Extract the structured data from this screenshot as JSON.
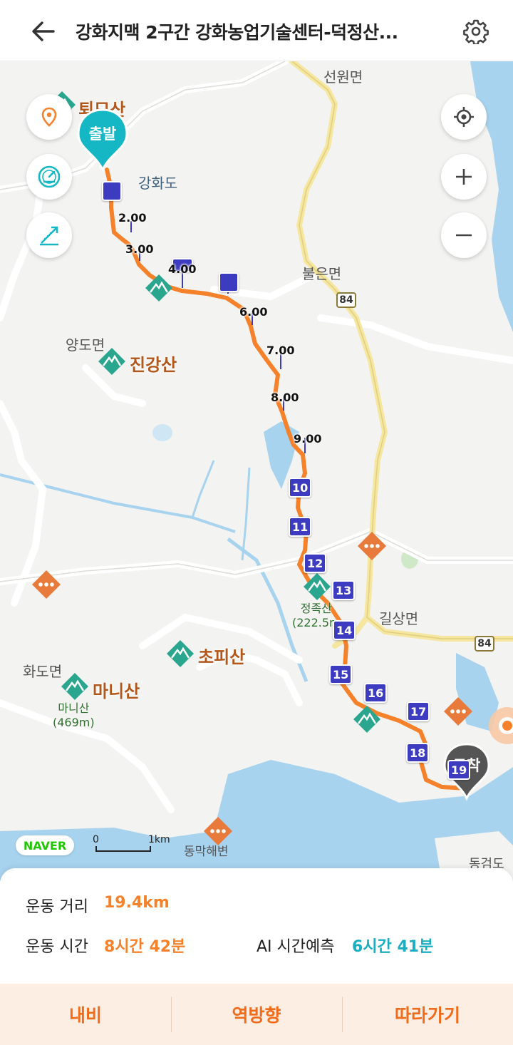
{
  "header": {
    "title": "강화지맥 2구간 강화농업기술센터-덕정산..."
  },
  "map": {
    "places": {
      "seonwon": "선원면",
      "ganghwado": "강화도",
      "bureun": "불은면",
      "yangdo": "양도면",
      "gilsang": "길상면",
      "hwado": "화도면",
      "dongmak": "동막해변",
      "donggeom": "동검도"
    },
    "mountains": {
      "toemo": "퇴모산",
      "jingang": "진강산",
      "chopi": "초피산",
      "mani": "마니산",
      "mani_sub1": "마니산",
      "mani_sub2": "(469m)",
      "jeongjok_sub1": "정족산",
      "jeongjok_sub2": "(222.5m"
    },
    "road_badges": [
      "84",
      "84"
    ],
    "start_label": "출발",
    "end_label": "도착",
    "km_labels": [
      "2.00",
      "3.00",
      "4.00",
      "6.00",
      "7.00",
      "8.00",
      "9.00"
    ],
    "km_boxes": [
      "10",
      "11",
      "12",
      "13",
      "14",
      "15",
      "16",
      "17",
      "18",
      "19"
    ],
    "scale": {
      "zero": "0",
      "unit": "1km"
    },
    "logo": "NAVER",
    "route_color": "#f5822a",
    "marker_color": "#3d3bbf"
  },
  "info": {
    "distance_label": "운동 거리",
    "distance_value": "19.4km",
    "time_label": "운동 시간",
    "time_value": "8시간 42분",
    "ai_label": "AI 시간예측",
    "ai_value": "6시간 41분"
  },
  "actions": {
    "nav": "내비",
    "reverse": "역방향",
    "follow": "따라가기"
  }
}
